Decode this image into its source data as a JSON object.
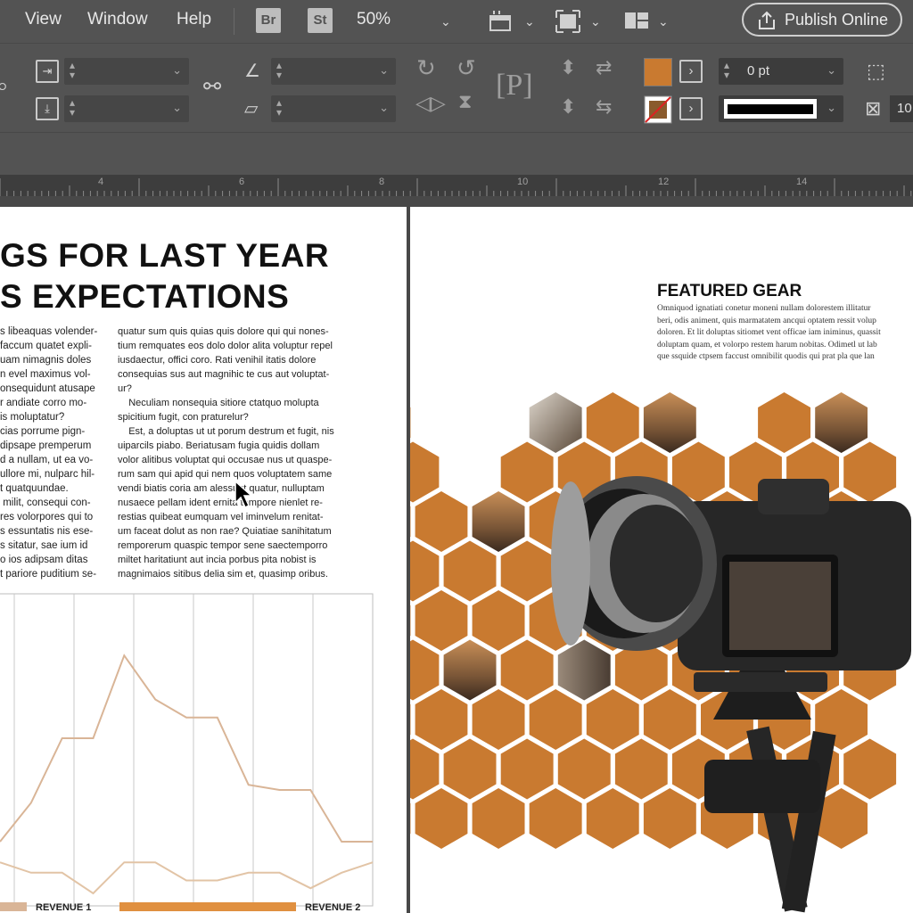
{
  "menubar": {
    "items": [
      "View",
      "Window",
      "Help"
    ],
    "bridge_label": "Br",
    "stock_label": "St",
    "zoom": "50%",
    "publish_label": "Publish Online"
  },
  "control_panel": {
    "stroke_weight": "0 pt",
    "scale_value": "10",
    "fill_color": "#c97a30"
  },
  "ruler": {
    "ticks": [
      "4",
      "6",
      "8",
      "10",
      "12",
      "14"
    ]
  },
  "document": {
    "headline_line1": "GS FOR LAST YEAR",
    "headline_line2": "S EXPECTATIONS",
    "body_col1": "s libeaquas volender-\nfaccum quatet expli-\nuam nimagnis doles\nn evel maximus vol-\nonsequidunt atusape\nr andiate corro mo-\nis moluptatur?\ncias porrume pign-\ndipsape premperum\nd a nullam, ut ea vo-\nullore mi, nulparc hil-\nt quatquundae.\n milit, consequi con-\nres volorpores qui to\ns essuntatis nis ese-\ns sitatur, sae ium id\no ios adipsam ditas\nt pariore puditium se-",
    "body_col2": "quatur sum quis quias quis dolore qui qui nones-\ntium remquates eos dolo dolor alita voluptur repel\niusdaectur, offici coro. Rati venihil itatis dolore\nconsequias sus aut magnihic te cus aut voluptat-\nur?\n    Neculiam nonsequia sitiore ctatquo molupta\nspicitium fugit, con praturelur?\n    Est, a doluptas ut ut porum destrum et fugit, nis\nuiparcils piabo. Beriatusam fugia quidis dollam\nvolor alitibus voluptat qui occusae nus ut quaspe-\nrum sam qui apid qui nem quos voluptatem same\nvendi biatis coria am alessunt quatur, nulluptam\nnusaece pellam ident ernita tempore nienlet re-\nrestias quibeat eumquam vel iminvelum renitat-\num faceat dolut as non rae? Quiatiae sanihitatum\nremporerum quaspic tempor sene saectemporro\nmiltet haritatiunt aut incia porbus pita nobist is\nmagnimaios sitibus delia sim et, quasimp oribus.",
    "legend1": "REVENUE 1",
    "legend2": "REVENUE 2",
    "feature_title": "FEATURED GEAR",
    "feature_text": "Omniquod ignatiati conetur moneni nullam dolorestem illitatur\nberi, odis animent, quis marmatatem ancqui optatem ressit volup\ndoloren. Et lit doluptas sitiomet vent officae iam iniminus, quassit\ndoluptam quam, et volorpo restem harum nobitas. Odimetl ut lab\nque ssquide ctpsem faccust omnibilit quodis qui prat pla que lan"
  },
  "chart_data": {
    "type": "line",
    "title": "",
    "xlabel": "",
    "ylabel": "",
    "x": [
      0,
      1,
      2,
      3,
      4,
      5,
      6,
      7,
      8,
      9,
      10,
      11,
      12
    ],
    "ylim": [
      0,
      100
    ],
    "grid": true,
    "legend_position": "bottom",
    "series": [
      {
        "name": "REVENUE 1",
        "color": "#d9b597",
        "values": [
          20,
          35,
          60,
          60,
          92,
          75,
          68,
          68,
          42,
          40,
          40,
          20,
          20
        ]
      },
      {
        "name": "REVENUE 2",
        "color": "#e2c4a6",
        "values": [
          12,
          8,
          8,
          0,
          12,
          12,
          5,
          5,
          8,
          8,
          2,
          8,
          12
        ]
      }
    ]
  }
}
